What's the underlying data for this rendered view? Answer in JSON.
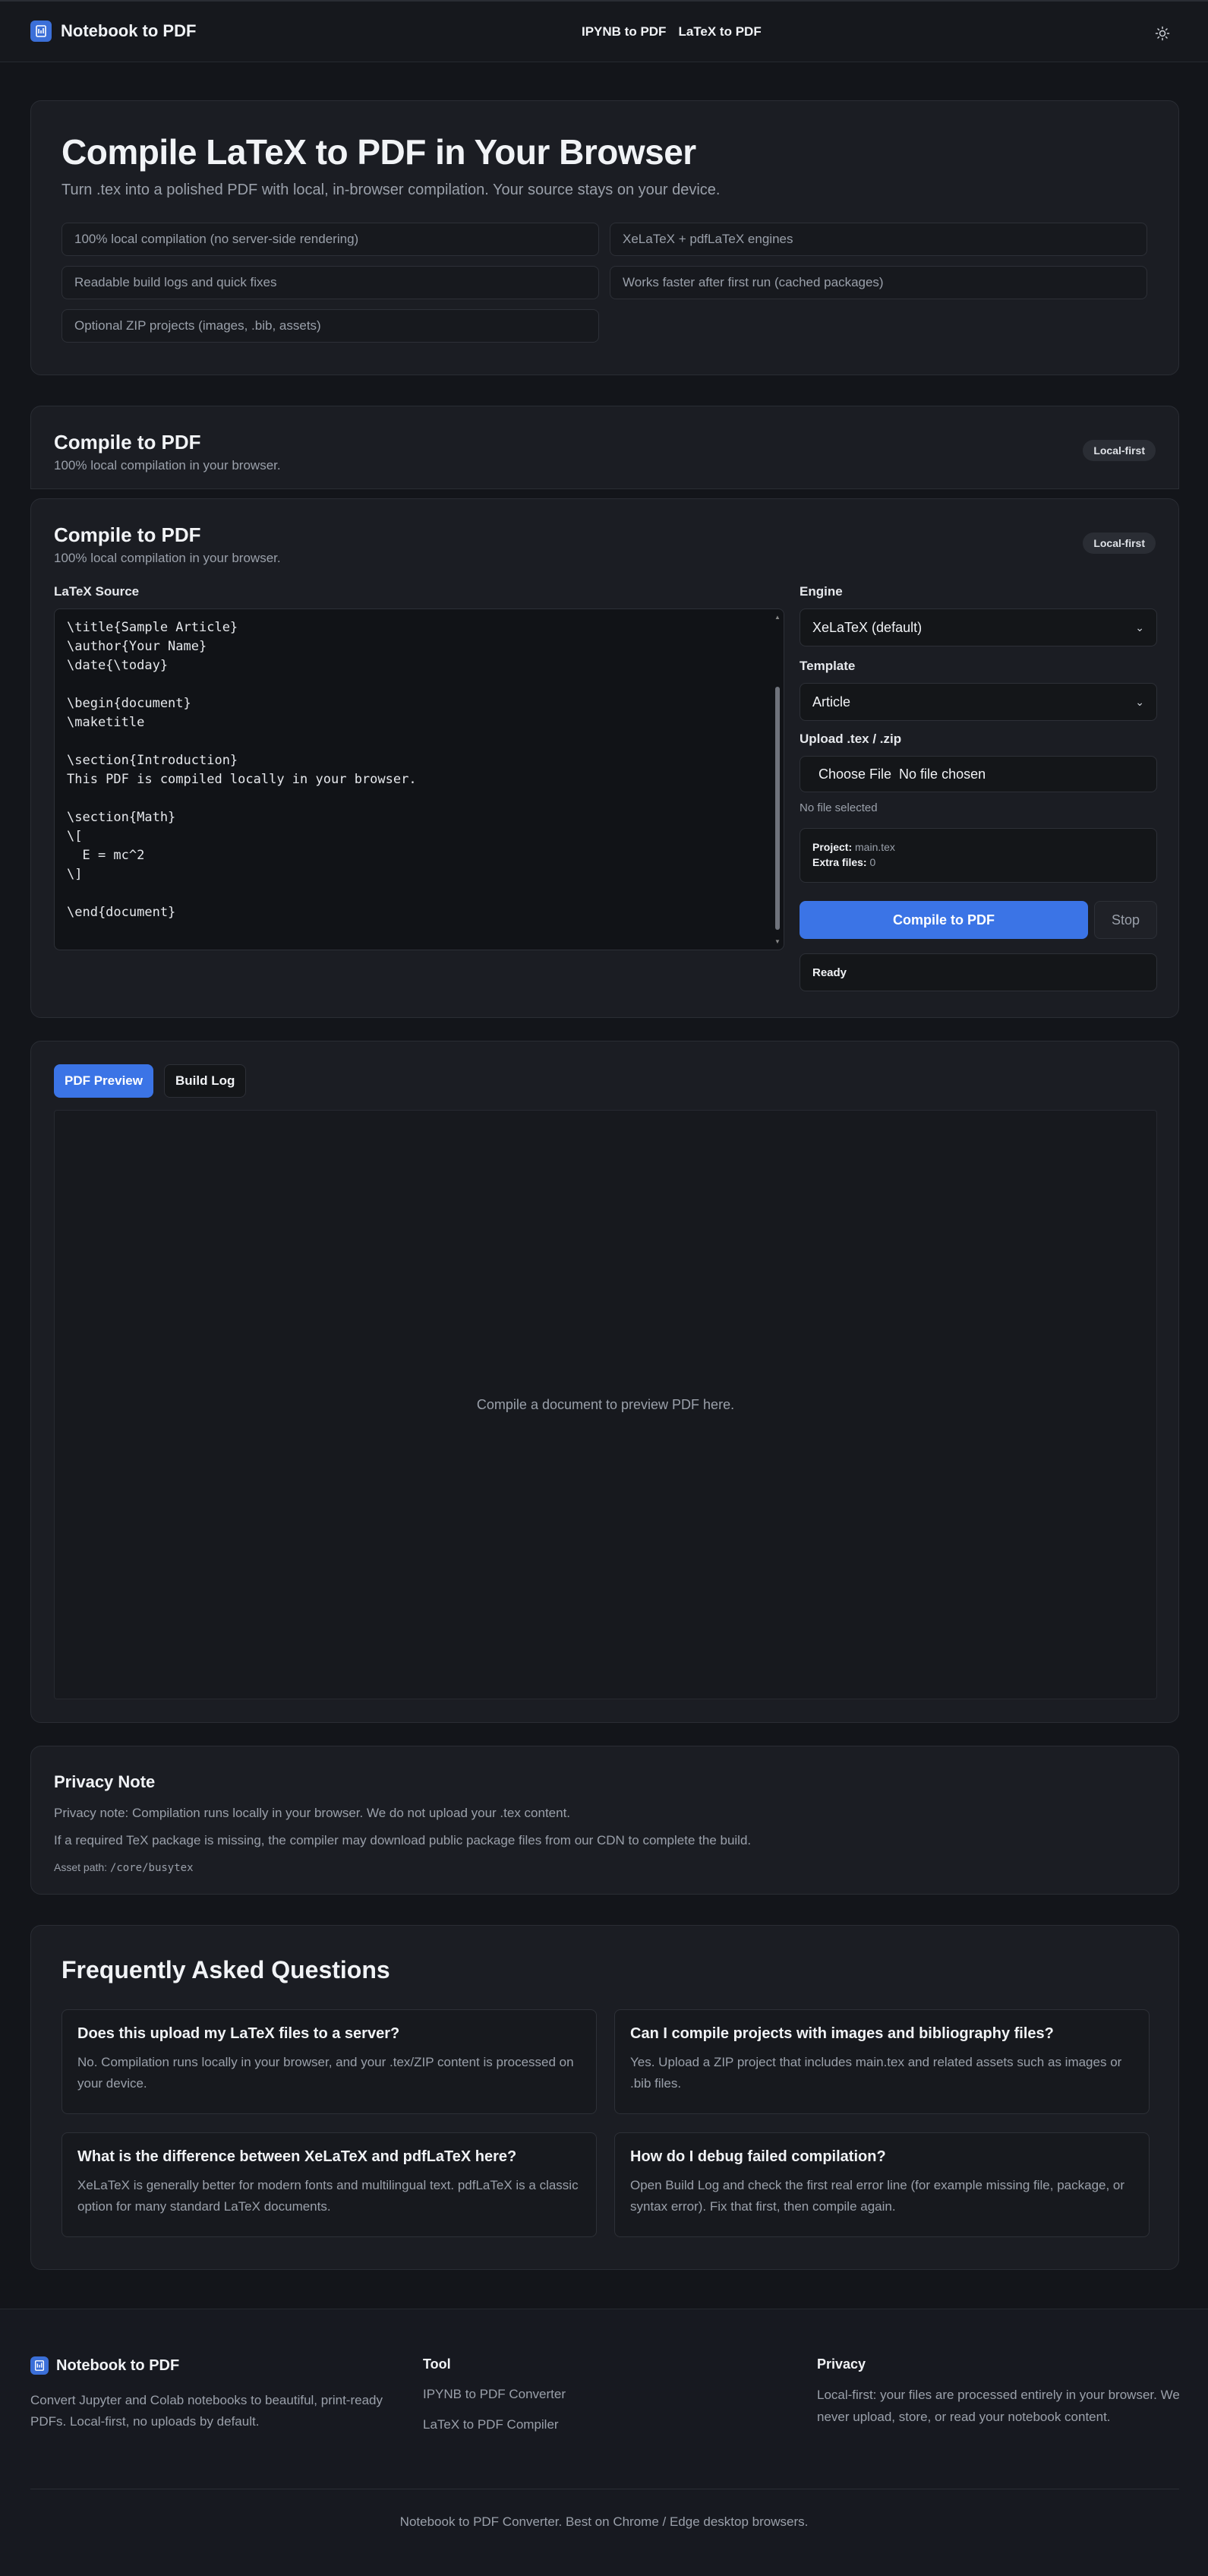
{
  "header": {
    "brand": "Notebook to PDF",
    "nav": [
      {
        "label": "IPYNB to PDF"
      },
      {
        "label": "LaTeX to PDF"
      }
    ],
    "theme_icon": "sun-icon"
  },
  "hero": {
    "title": "Compile LaTeX to PDF in Your Browser",
    "subtitle": "Turn .tex into a polished PDF with local, in-browser compilation. Your source stays on your device.",
    "features": [
      "100% local compilation (no server-side rendering)",
      "XeLaTeX + pdfLaTeX engines",
      "Readable build logs and quick fixes",
      "Works faster after first run (cached packages)",
      "Optional ZIP projects (images, .bib, assets)"
    ]
  },
  "compile_collapsed": {
    "title": "Compile to PDF",
    "subtitle": "100% local compilation in your browser.",
    "badge": "Local-first"
  },
  "compile": {
    "title": "Compile to PDF",
    "subtitle": "100% local compilation in your browser.",
    "badge": "Local-first",
    "source_label": "LaTeX Source",
    "source": "\\title{Sample Article}\n\\author{Your Name}\n\\date{\\today}\n\n\\begin{document}\n\\maketitle\n\n\\section{Introduction}\nThis PDF is compiled locally in your browser.\n\n\\section{Math}\n\\[\n  E = mc^2\n\\]\n\n\\end{document}",
    "engine_label": "Engine",
    "engine_value": "XeLaTeX (default)",
    "template_label": "Template",
    "template_value": "Article",
    "upload_label": "Upload .tex / .zip",
    "choose_file": "Choose File",
    "no_file_chosen": "No file chosen",
    "no_file_selected": "No file selected",
    "project_label": "Project:",
    "project_value": "main.tex",
    "extra_label": "Extra files:",
    "extra_value": "0",
    "compile_button": "Compile to PDF",
    "stop_button": "Stop",
    "status": "Ready"
  },
  "preview": {
    "tabs": [
      "PDF Preview",
      "Build Log"
    ],
    "placeholder": "Compile a document to preview PDF here."
  },
  "privacy": {
    "title": "Privacy Note",
    "line1": "Privacy note: Compilation runs locally in your browser. We do not upload your .tex content.",
    "line2": "If a required TeX package is missing, the compiler may download public package files from our CDN to complete the build.",
    "asset_label": "Asset path:",
    "asset_path": "/core/busytex"
  },
  "faq": {
    "title": "Frequently Asked Questions",
    "items": [
      {
        "q": "Does this upload my LaTeX files to a server?",
        "a": "No. Compilation runs locally in your browser, and your .tex/ZIP content is processed on your device."
      },
      {
        "q": "Can I compile projects with images and bibliography files?",
        "a": "Yes. Upload a ZIP project that includes main.tex and related assets such as images or .bib files."
      },
      {
        "q": "What is the difference between XeLaTeX and pdfLaTeX here?",
        "a": "XeLaTeX is generally better for modern fonts and multilingual text. pdfLaTeX is a classic option for many standard LaTeX documents."
      },
      {
        "q": "How do I debug failed compilation?",
        "a": "Open Build Log and check the first real error line (for example missing file, package, or syntax error). Fix that first, then compile again."
      }
    ]
  },
  "footer": {
    "brand": "Notebook to PDF",
    "description": "Convert Jupyter and Colab notebooks to beautiful, print-ready PDFs. Local-first, no uploads by default.",
    "tool_heading": "Tool",
    "tool_links": [
      "IPYNB to PDF Converter",
      "LaTeX to PDF Compiler"
    ],
    "privacy_heading": "Privacy",
    "privacy_text": "Local-first: your files are processed entirely in your browser. We never upload, store, or read your notebook content.",
    "bottom": "Notebook to PDF Converter. Best on Chrome / Edge desktop browsers."
  },
  "colors": {
    "accent": "#3b74e6",
    "background": "#13151a",
    "card": "#1b1d23"
  }
}
